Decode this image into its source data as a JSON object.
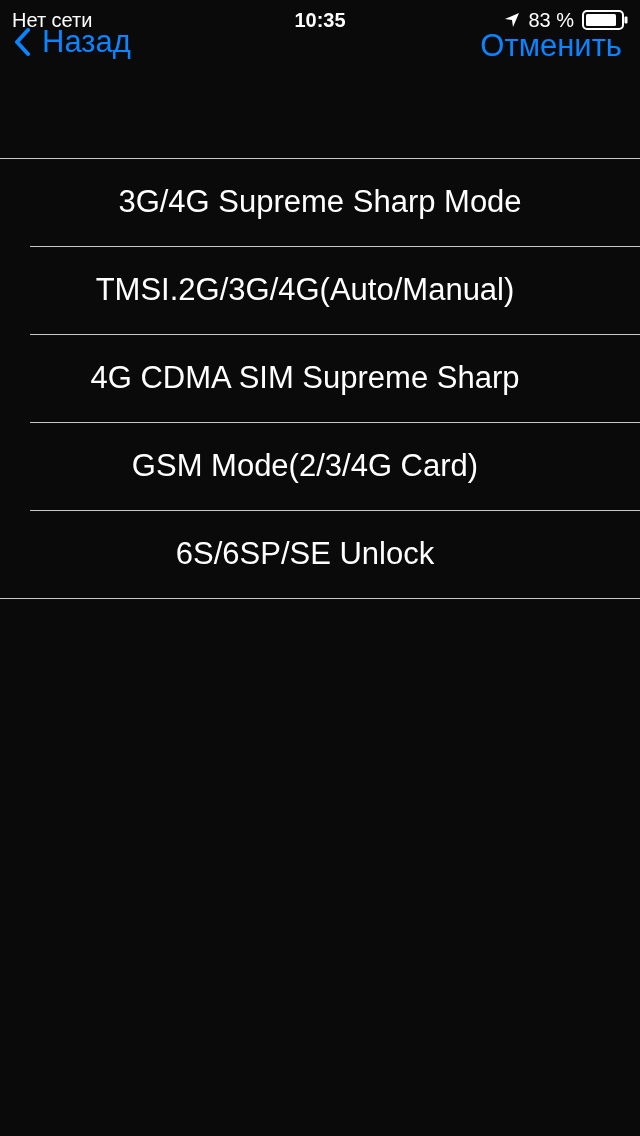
{
  "status_bar": {
    "carrier": "Нет сети",
    "time": "10:35",
    "battery": "83 %"
  },
  "nav": {
    "back": "Назад",
    "cancel": "Отменить"
  },
  "items": [
    {
      "label": "3G/4G Supreme Sharp Mode"
    },
    {
      "label": "TMSI.2G/3G/4G(Auto/Manual)"
    },
    {
      "label": "4G CDMA SIM Supreme Sharp"
    },
    {
      "label": "GSM Mode(2/3/4G Card)"
    },
    {
      "label": "6S/6SP/SE Unlock"
    }
  ]
}
